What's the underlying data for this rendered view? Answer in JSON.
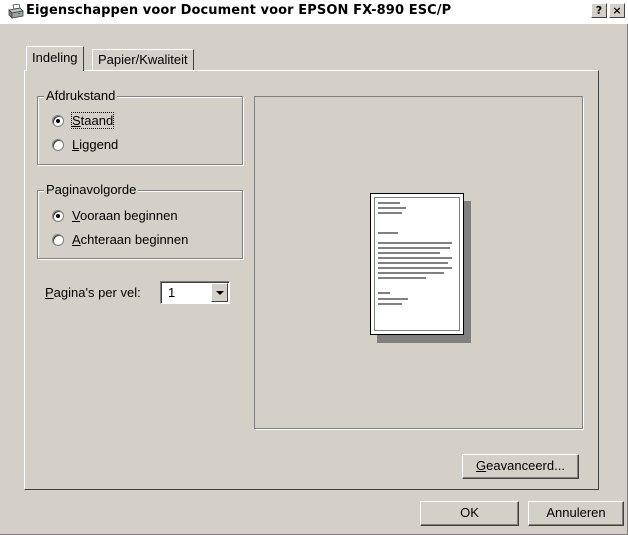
{
  "window": {
    "title": "Eigenschappen voor Document voor EPSON FX-890 ESC/P",
    "help_label": "?",
    "close_label": "×"
  },
  "tabs": [
    {
      "label": "Indeling",
      "active": true
    },
    {
      "label": "Papier/Kwaliteit",
      "active": false
    }
  ],
  "orientation": {
    "title": "Afdrukstand",
    "options": [
      {
        "label": "Staand",
        "mnemonic": "S",
        "rest": "taand",
        "checked": true
      },
      {
        "label": "Liggend",
        "mnemonic": "L",
        "rest": "iggend",
        "checked": false
      }
    ]
  },
  "page_order": {
    "title": "Paginavolgorde",
    "options": [
      {
        "label": "Vooraan beginnen",
        "mnemonic": "V",
        "rest": "ooraan beginnen",
        "checked": true
      },
      {
        "label": "Achteraan beginnen",
        "mnemonic": "A",
        "rest": "chteraan beginnen",
        "checked": false
      }
    ]
  },
  "pages_per_sheet": {
    "label_mnemonic": "P",
    "label_rest": "agina's per vel:",
    "value": "1"
  },
  "advanced_button": {
    "mnemonic": "G",
    "rest": "eavanceerd..."
  },
  "footer": {
    "ok_label": "OK",
    "cancel_label": "Annuleren"
  },
  "icons": {
    "title_icon": "printer-icon",
    "dropdown_icon": "chevron-down-icon"
  }
}
